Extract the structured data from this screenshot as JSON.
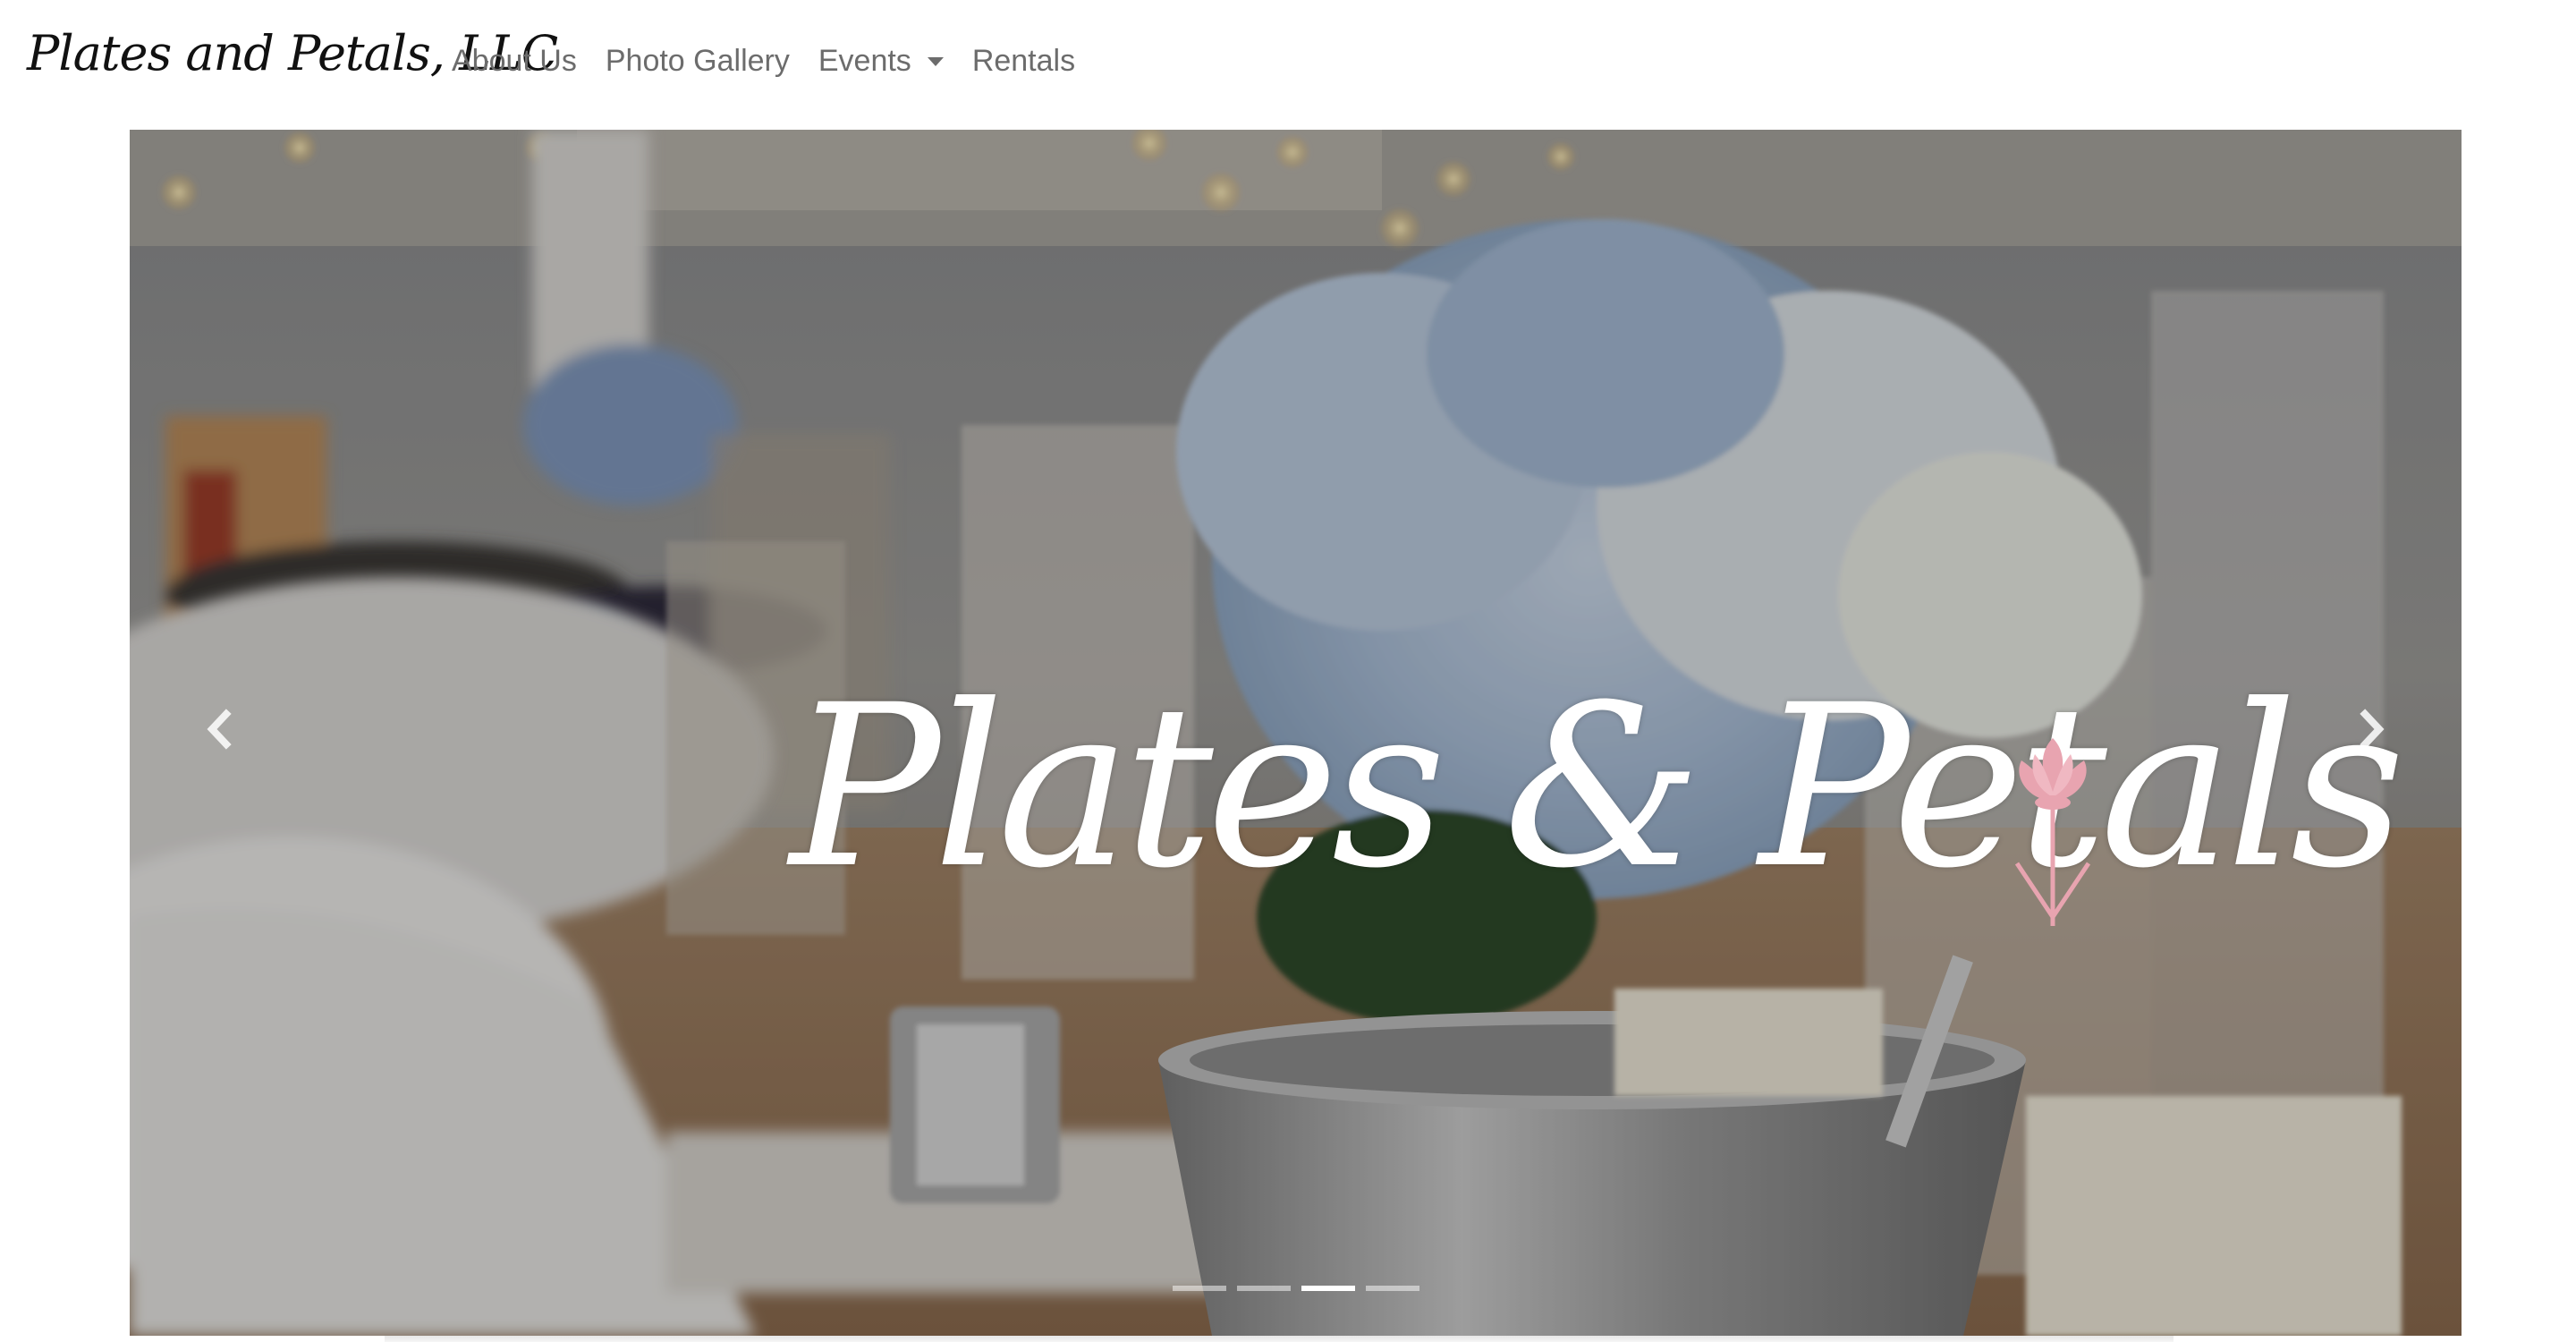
{
  "navbar": {
    "brand": "Plates and Petals, LLC",
    "links": [
      {
        "label": "About Us"
      },
      {
        "label": "Photo Gallery"
      },
      {
        "label": "Events",
        "dropdown": true
      },
      {
        "label": "Rentals"
      }
    ]
  },
  "carousel": {
    "slide_title": "Plates & Petals",
    "slide_count": 4,
    "active_slide": 3,
    "prev_icon": "chevron-left-icon",
    "next_icon": "chevron-right-icon"
  },
  "colors": {
    "nav_text": "#6c6c6c",
    "brand_text": "#111111",
    "hero_text": "#ffffff",
    "flower_accent": "#e8a4b0"
  }
}
